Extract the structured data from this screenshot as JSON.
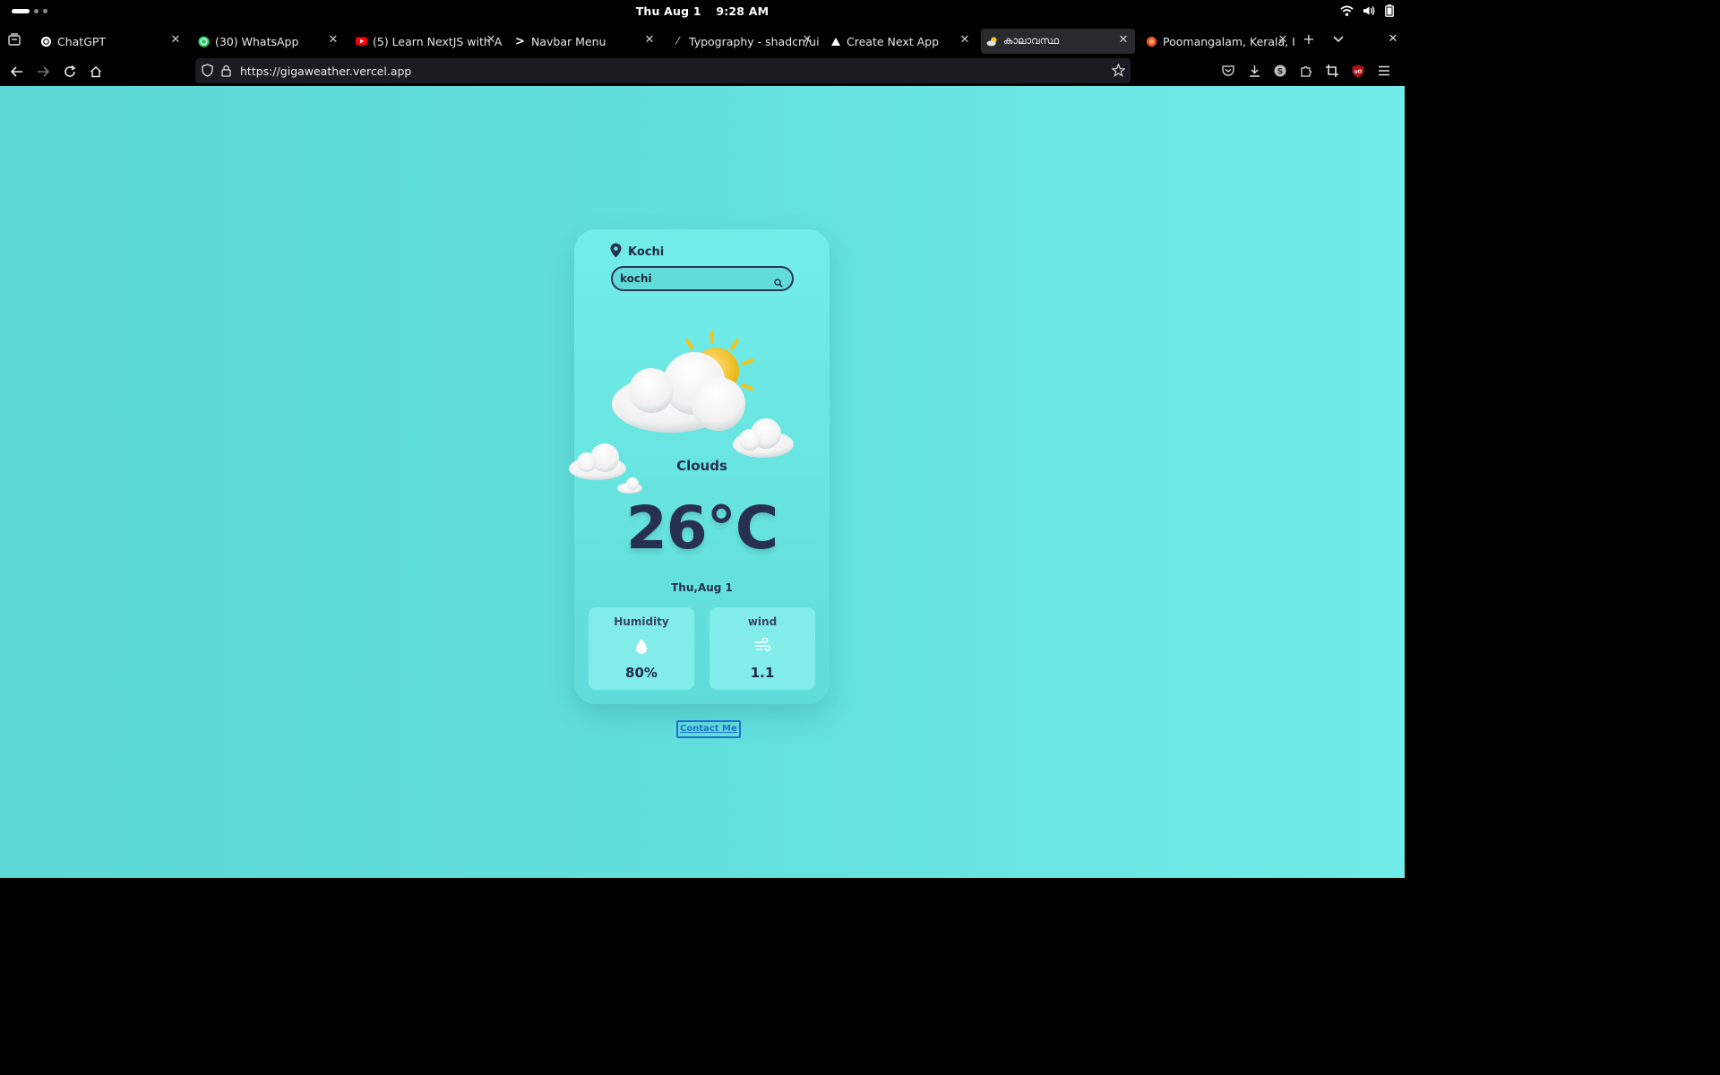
{
  "system": {
    "day": "Thu Aug 1",
    "time": "9:28 AM"
  },
  "tabs": [
    {
      "label": "ChatGPT",
      "favicon": "chatgpt-icon"
    },
    {
      "label": "(30) WhatsApp",
      "favicon": "whatsapp-icon"
    },
    {
      "label": "(5) Learn NextJS with Ac",
      "favicon": "youtube-icon"
    },
    {
      "label": "Navbar Menu",
      "favicon": "chevron-right-icon"
    },
    {
      "label": "Typography - shadcn/ui",
      "favicon": "slash-icon"
    },
    {
      "label": "Create Next App",
      "favicon": "triangle-icon"
    },
    {
      "label": "കാലാവസ്ഥ",
      "favicon": "weather-icon",
      "active": true
    },
    {
      "label": "Poomangalam, Kerala, I",
      "favicon": "globe-icon"
    }
  ],
  "url": "https://gigaweather.vercel.app",
  "weather": {
    "location": "Kochi",
    "search_value": "kochi",
    "condition": "Clouds",
    "temperature": "26°C",
    "date": "Thu,Aug 1",
    "humidity_label": "Humidity",
    "humidity_value": "80%",
    "wind_label": "wind",
    "wind_value": "1.1"
  },
  "contact_label": "Contact Me",
  "colors": {
    "background": "#62e0de",
    "text_dark": "#27304f",
    "link": "#1f6fd1",
    "sun": "#f5c518"
  }
}
